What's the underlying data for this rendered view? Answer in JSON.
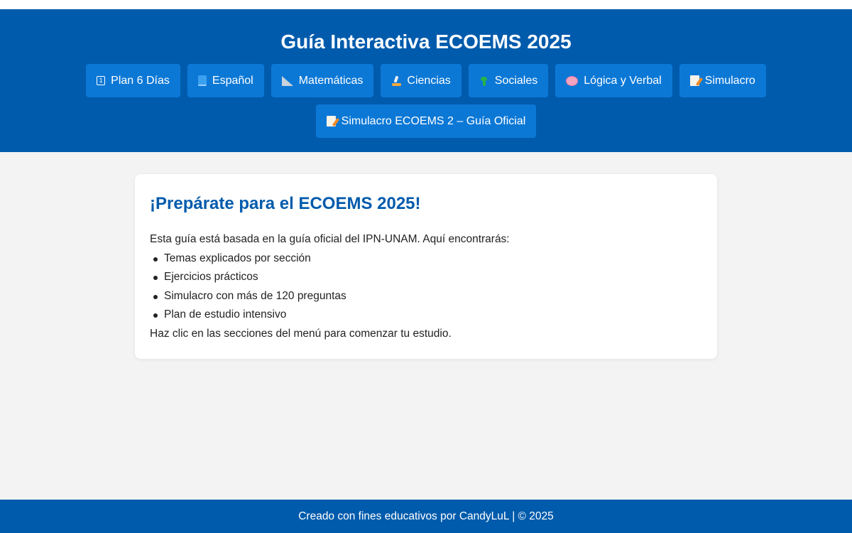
{
  "header": {
    "title": "Guía Interactiva ECOEMS 2025"
  },
  "nav": {
    "items": [
      {
        "label": "Plan 6 Días",
        "icon": "calendar-icon"
      },
      {
        "label": "Español",
        "icon": "book-icon"
      },
      {
        "label": "Matemáticas",
        "icon": "triangle-ruler-icon"
      },
      {
        "label": "Ciencias",
        "icon": "microscope-icon"
      },
      {
        "label": "Sociales",
        "icon": "globe-icon"
      },
      {
        "label": "Lógica y Verbal",
        "icon": "brain-icon"
      },
      {
        "label": "Simulacro",
        "icon": "memo-icon"
      },
      {
        "label": "Simulacro ECOEMS 2 – Guía Oficial",
        "icon": "memo-icon"
      }
    ]
  },
  "main": {
    "heading": "¡Prepárate para el ECOEMS 2025!",
    "intro": "Esta guía está basada en la guía oficial del IPN-UNAM. Aquí encontrarás:",
    "list": [
      "Temas explicados por sección",
      "Ejercicios prácticos",
      "Simulacro con más de 120 preguntas",
      "Plan de estudio intensivo"
    ],
    "outro": "Haz clic en las secciones del menú para comenzar tu estudio."
  },
  "footer": {
    "text": "Creado con fines educativos por CandyLuL | © 2025"
  },
  "colors": {
    "primary": "#005bac",
    "button": "#0c78d6",
    "background": "#f3f3f3"
  }
}
